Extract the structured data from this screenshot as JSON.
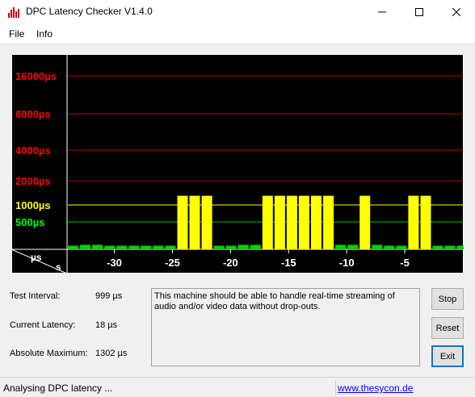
{
  "window": {
    "title": "DPC Latency Checker V1.4.0"
  },
  "menu": {
    "file": "File",
    "info": "Info"
  },
  "chart_data": {
    "type": "bar",
    "ylabel_unit": "µs",
    "xlabel_unit": "s",
    "y_ticks": [
      {
        "label": "16000µs",
        "value": 16000,
        "color": "#ff0000",
        "line": "#b00000"
      },
      {
        "label": "8000µs",
        "value": 8000,
        "color": "#ff0000",
        "line": "#b00000"
      },
      {
        "label": "4000µs",
        "value": 4000,
        "color": "#ff0000",
        "line": "#b00000"
      },
      {
        "label": "2000µs",
        "value": 2000,
        "color": "#ff0000",
        "line": "#b00000"
      },
      {
        "label": "1000µs",
        "value": 1000,
        "color": "#ffff00",
        "line": "#ffff00"
      },
      {
        "label": "500µs",
        "value": 500,
        "color": "#00ff00",
        "line": "#00c000"
      }
    ],
    "x_ticks": [
      "-30",
      "-25",
      "-20",
      "-15",
      "-10",
      "-5"
    ],
    "x_tick_values": [
      -30,
      -25,
      -20,
      -15,
      -10,
      -5
    ],
    "x_range": [
      -34,
      0
    ],
    "values": [
      80,
      100,
      100,
      80,
      80,
      80,
      80,
      80,
      80,
      1302,
      1302,
      1302,
      80,
      80,
      100,
      100,
      1302,
      1302,
      1302,
      1302,
      1302,
      1302,
      100,
      100,
      1302,
      100,
      80,
      80,
      1302,
      1302,
      80,
      80,
      80,
      80,
      80
    ]
  },
  "stats": {
    "test_interval_label": "Test Interval:",
    "test_interval_value": "999 µs",
    "current_latency_label": "Current Latency:",
    "current_latency_value": "18 µs",
    "absolute_max_label": "Absolute Maximum:",
    "absolute_max_value": "1302 µs"
  },
  "message": "This machine should be able to handle real-time streaming of audio and/or video data without drop-outs.",
  "buttons": {
    "stop": "Stop",
    "reset": "Reset",
    "exit": "Exit"
  },
  "status": {
    "text": "Analysing DPC latency ...",
    "link": "www.thesycon.de"
  }
}
